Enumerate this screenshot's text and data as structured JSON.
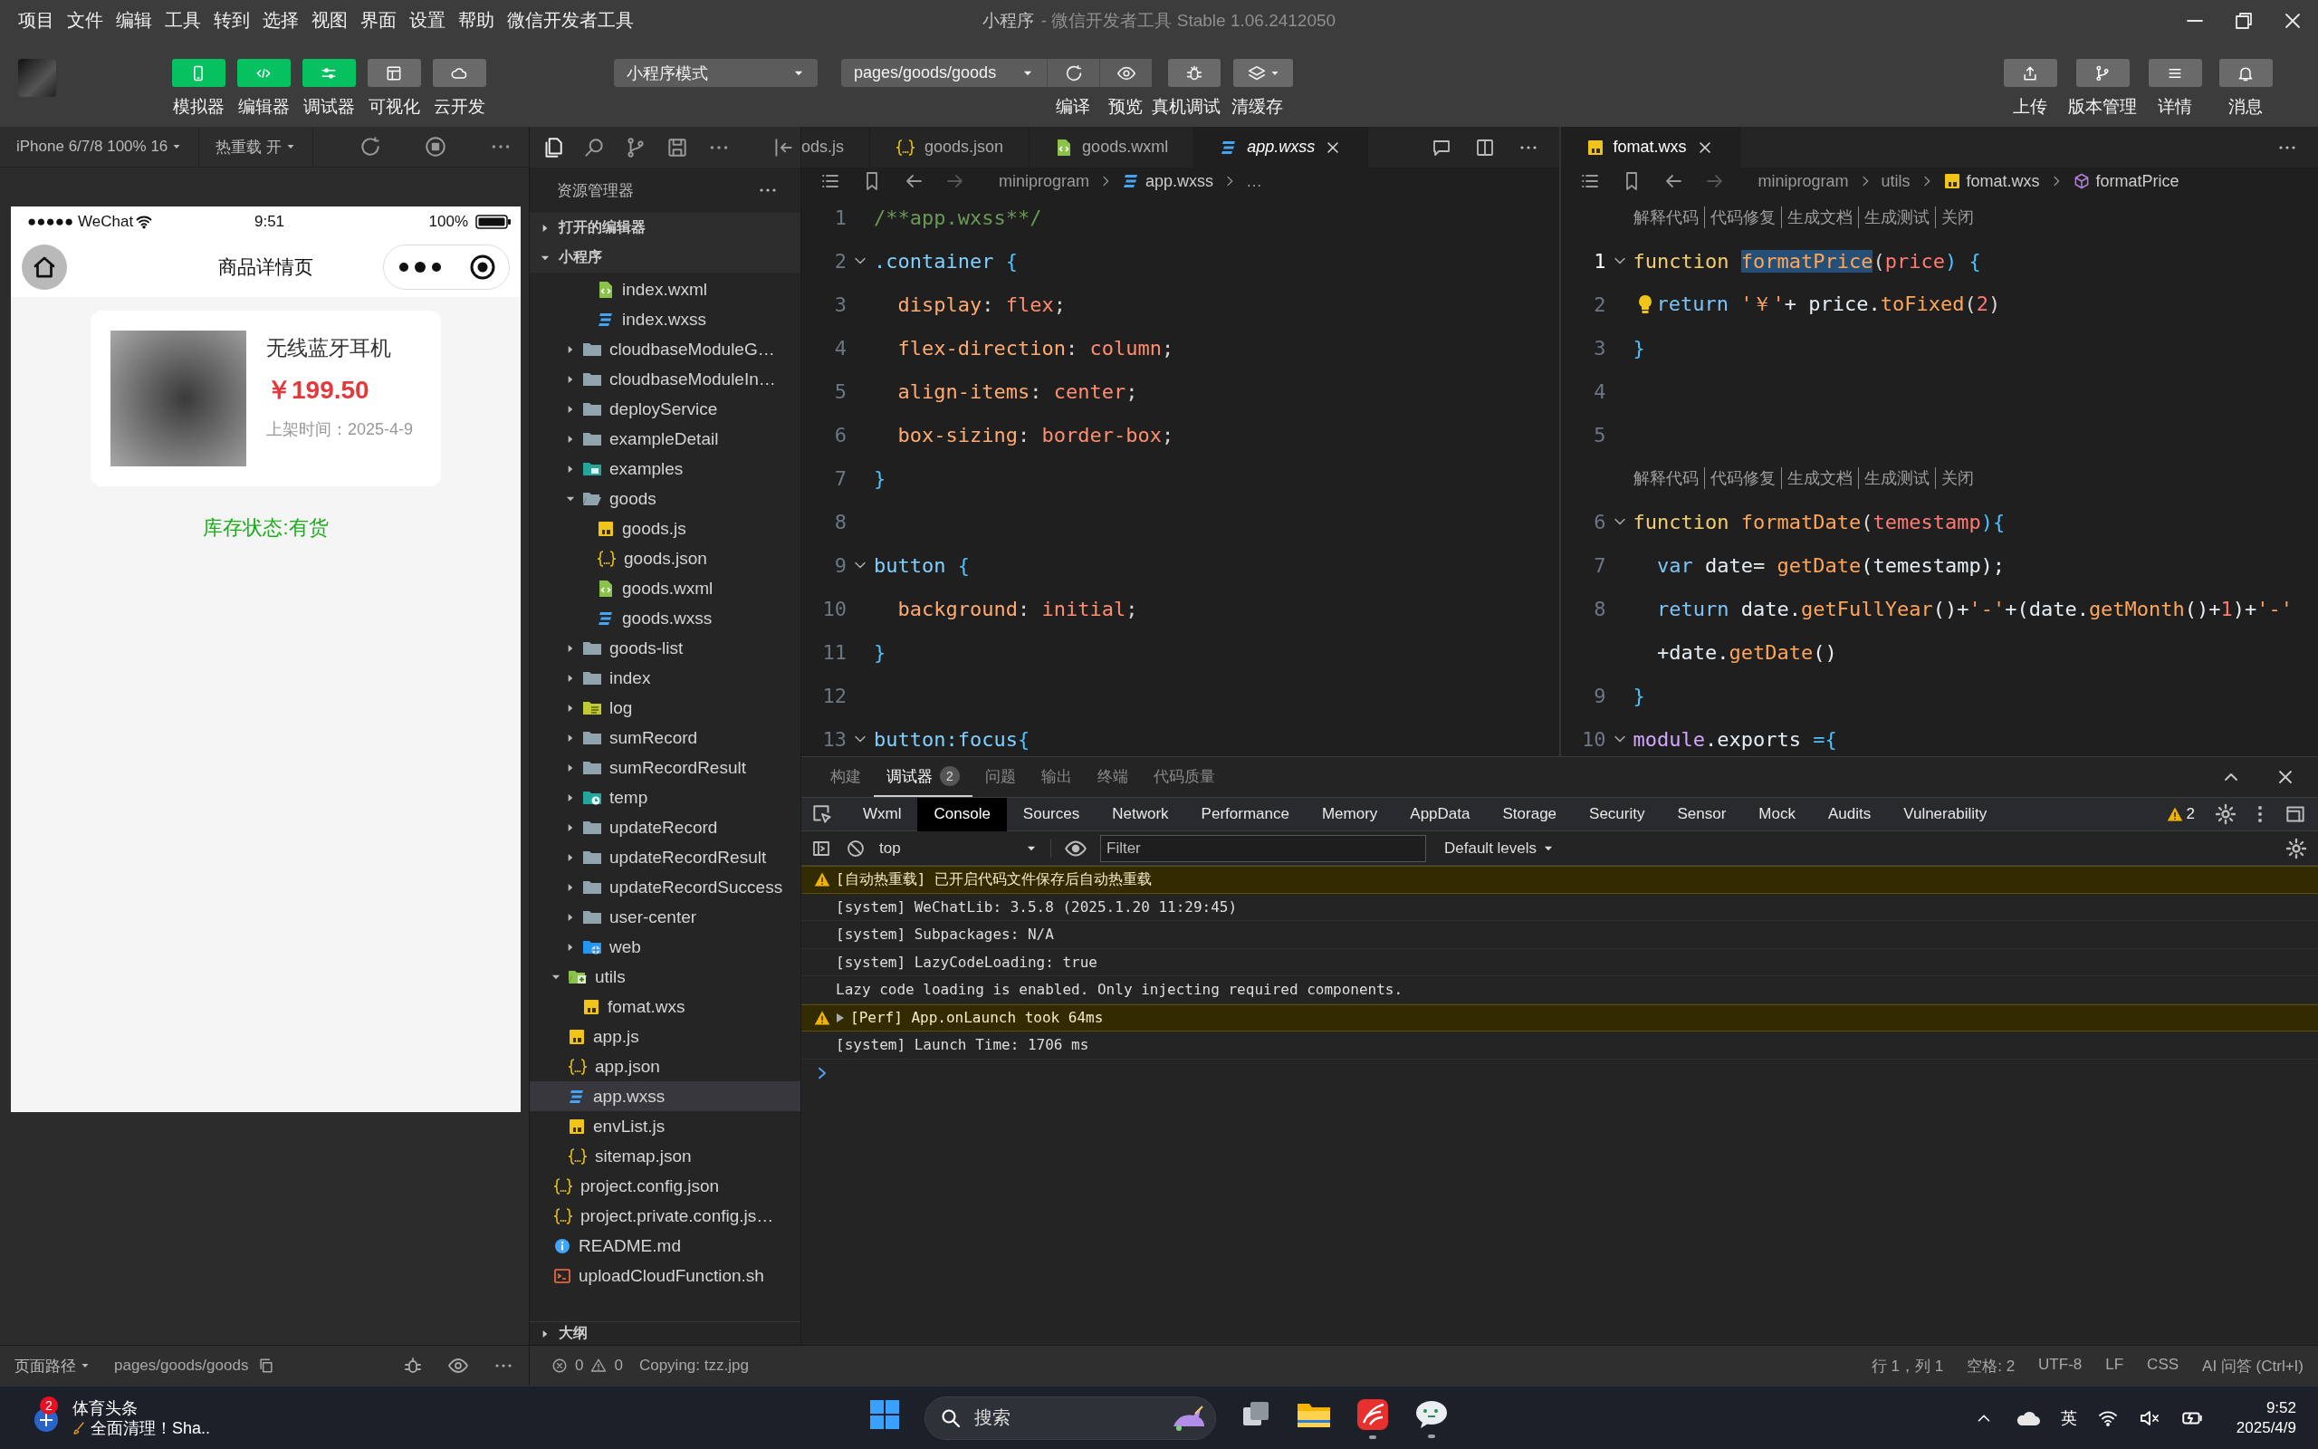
{
  "menu": [
    "项目",
    "文件",
    "编辑",
    "工具",
    "转到",
    "选择",
    "视图",
    "界面",
    "设置",
    "帮助",
    "微信开发者工具"
  ],
  "title": {
    "project": "小程序",
    "rest": "- 微信开发者工具 Stable 1.06.2412050"
  },
  "toolbar": {
    "view_toggles": [
      {
        "label": "模拟器",
        "on": true
      },
      {
        "label": "编辑器",
        "on": true
      },
      {
        "label": "调试器",
        "on": true
      },
      {
        "label": "可视化",
        "on": false
      },
      {
        "label": "云开发",
        "on": false
      }
    ],
    "mode": "小程序模式",
    "page": "pages/goods/goods",
    "actions": [
      "编译",
      "预览",
      "真机调试",
      "清缓存"
    ],
    "right": [
      "上传",
      "版本管理",
      "详情",
      "消息"
    ]
  },
  "simulator": {
    "device": "iPhone 6/7/8 100% 16",
    "hot_reload": "热重载 开",
    "carrier": "●●●●● WeChat",
    "time": "9:51",
    "battery": "100%",
    "title": "商品详情页",
    "product": {
      "name": "无线蓝牙耳机",
      "price": "￥199.50",
      "listed": "上架时间：2025-4-9"
    },
    "stock": "库存状态:有货"
  },
  "explorer": {
    "title": "资源管理器",
    "sections": [
      {
        "label": "打开的编辑器",
        "expanded": false
      },
      {
        "label": "小程序",
        "expanded": true
      }
    ],
    "tree": [
      {
        "children": [
          {
            "children": [
              {
                "children": [
                  {
                    "label": "index.wxml",
                    "kind": "wxml",
                    "selected": false
                  },
                  {
                    "label": "index.wxss",
                    "kind": "wxss",
                    "selected": false
                  }
                ]
              },
              {
                "label": "cloudbaseModuleG…",
                "kind": "folder",
                "expanded": false,
                "selected": false
              },
              {
                "label": "cloudbaseModuleIn…",
                "kind": "folder",
                "expanded": false,
                "selected": false
              },
              {
                "label": "deployService",
                "kind": "folder",
                "expanded": false,
                "selected": false
              },
              {
                "label": "exampleDetail",
                "kind": "folder",
                "expanded": false,
                "selected": false
              },
              {
                "label": "examples",
                "kind": "folder-image",
                "expanded": false,
                "selected": false
              },
              {
                "label": "goods",
                "kind": "folder",
                "expanded": true,
                "selected": false,
                "children": [
                  {
                    "label": "goods.js",
                    "kind": "js",
                    "selected": false
                  },
                  {
                    "label": "goods.json",
                    "kind": "json",
                    "selected": false
                  },
                  {
                    "label": "goods.wxml",
                    "kind": "wxml",
                    "selected": false
                  },
                  {
                    "label": "goods.wxss",
                    "kind": "wxss",
                    "selected": false
                  }
                ]
              },
              {
                "label": "goods-list",
                "kind": "folder",
                "expanded": false,
                "selected": false
              },
              {
                "label": "index",
                "kind": "folder",
                "expanded": false,
                "selected": false
              },
              {
                "label": "log",
                "kind": "folder-log",
                "expanded": false,
                "selected": false
              },
              {
                "label": "sumRecord",
                "kind": "folder",
                "expanded": false,
                "selected": false
              },
              {
                "label": "sumRecordResult",
                "kind": "folder",
                "expanded": false,
                "selected": false
              },
              {
                "label": "temp",
                "kind": "folder-temp",
                "expanded": false,
                "selected": false
              },
              {
                "label": "updateRecord",
                "kind": "folder",
                "expanded": false,
                "selected": false
              },
              {
                "label": "updateRecordResult",
                "kind": "folder",
                "expanded": false,
                "selected": false
              },
              {
                "label": "updateRecordSuccess",
                "kind": "folder",
                "expanded": false,
                "selected": false
              },
              {
                "label": "user-center",
                "kind": "folder",
                "expanded": false,
                "selected": false
              },
              {
                "label": "web",
                "kind": "folder-web",
                "expanded": false,
                "selected": false
              }
            ]
          },
          {
            "label": "utils",
            "kind": "folder-utils",
            "expanded": true,
            "selected": false,
            "children": [
              {
                "label": "fomat.wxs",
                "kind": "js",
                "selected": false
              }
            ]
          },
          {
            "label": "app.js",
            "kind": "js",
            "selected": false
          },
          {
            "label": "app.json",
            "kind": "json",
            "selected": false
          },
          {
            "label": "app.wxss",
            "kind": "wxss",
            "selected": true
          },
          {
            "label": "envList.js",
            "kind": "js",
            "selected": false
          },
          {
            "label": "sitemap.json",
            "kind": "json",
            "selected": false
          }
        ]
      },
      {
        "label": "project.config.json",
        "kind": "json",
        "selected": false
      },
      {
        "label": "project.private.config.js…",
        "kind": "json",
        "selected": false
      },
      {
        "label": "README.md",
        "kind": "md",
        "selected": false
      },
      {
        "label": "uploadCloudFunction.sh",
        "kind": "sh",
        "selected": false
      }
    ],
    "outline": {
      "label": "大纲",
      "expanded": false
    }
  },
  "editors": [
    {
      "tabs": [
        {
          "label": "ods.js",
          "selected": false,
          "preview": false
        },
        {
          "label": "goods.json",
          "kind": "json",
          "selected": false,
          "preview": false
        },
        {
          "label": "goods.wxml",
          "kind": "wxml",
          "selected": false,
          "preview": false
        },
        {
          "label": "app.wxss",
          "kind": "wxss",
          "selected": true,
          "preview": true
        }
      ],
      "breadcrumb": [
        {
          "label": "miniprogram"
        },
        {
          "label": "app.wxss",
          "kind": "wxss"
        },
        {
          "label": "…"
        }
      ],
      "lines": [
        {
          "kind": "code",
          "number": "1",
          "fold": false,
          "current": false,
          "tokens": [
            {
              "text": "/**app.wxss**/",
              "kind": "comment"
            }
          ]
        },
        {
          "kind": "code",
          "number": "2",
          "fold": true,
          "current": false,
          "tokens": [
            {
              "text": ".container",
              "kind": "selector"
            },
            {
              "text": " {",
              "kind": "brace"
            }
          ]
        },
        {
          "kind": "code",
          "number": "3",
          "fold": false,
          "current": false,
          "tokens": [
            {
              "text": "  display",
              "kind": "property"
            },
            {
              "text": ": ",
              "kind": "punct"
            },
            {
              "text": "flex",
              "kind": "value"
            },
            {
              "text": ";",
              "kind": "punct"
            }
          ]
        },
        {
          "kind": "code",
          "number": "4",
          "fold": false,
          "current": false,
          "tokens": [
            {
              "text": "  flex-direction",
              "kind": "property"
            },
            {
              "text": ": ",
              "kind": "punct"
            },
            {
              "text": "column",
              "kind": "value"
            },
            {
              "text": ";",
              "kind": "punct"
            }
          ]
        },
        {
          "kind": "code",
          "number": "5",
          "fold": false,
          "current": false,
          "tokens": [
            {
              "text": "  align-items",
              "kind": "property"
            },
            {
              "text": ": ",
              "kind": "punct"
            },
            {
              "text": "center",
              "kind": "value"
            },
            {
              "text": ";",
              "kind": "punct"
            }
          ]
        },
        {
          "kind": "code",
          "number": "6",
          "fold": false,
          "current": false,
          "tokens": [
            {
              "text": "  box-sizing",
              "kind": "property"
            },
            {
              "text": ": ",
              "kind": "punct"
            },
            {
              "text": "border-box",
              "kind": "value"
            },
            {
              "text": ";",
              "kind": "punct"
            }
          ]
        },
        {
          "kind": "code",
          "number": "7",
          "fold": false,
          "current": false,
          "tokens": [
            {
              "text": "}",
              "kind": "brace"
            }
          ]
        },
        {
          "kind": "code",
          "number": "8",
          "fold": false,
          "current": false
        },
        {
          "kind": "code",
          "number": "9",
          "fold": true,
          "current": false,
          "tokens": [
            {
              "text": "button",
              "kind": "selector"
            },
            {
              "text": " {",
              "kind": "brace"
            }
          ]
        },
        {
          "kind": "code",
          "number": "10",
          "fold": false,
          "current": false,
          "tokens": [
            {
              "text": "  background",
              "kind": "property"
            },
            {
              "text": ": ",
              "kind": "punct"
            },
            {
              "text": "initial",
              "kind": "value"
            },
            {
              "text": ";",
              "kind": "punct"
            }
          ]
        },
        {
          "kind": "code",
          "number": "11",
          "fold": false,
          "current": false,
          "tokens": [
            {
              "text": "}",
              "kind": "brace"
            }
          ]
        },
        {
          "kind": "code",
          "number": "12",
          "fold": false,
          "current": false
        },
        {
          "kind": "code",
          "number": "13",
          "fold": true,
          "current": false,
          "tokens": [
            {
              "text": "button:focus",
              "kind": "selector"
            },
            {
              "text": "{",
              "kind": "brace"
            }
          ]
        }
      ]
    },
    {
      "tabs": [
        {
          "label": "fomat.wxs",
          "kind": "js",
          "selected": true,
          "preview": false
        }
      ],
      "breadcrumb": [
        {
          "label": "miniprogram"
        },
        {
          "label": "utils"
        },
        {
          "label": "fomat.wxs",
          "kind": "js"
        },
        {
          "label": "formatPrice",
          "kind": "symbol"
        }
      ],
      "lines": [
        {
          "kind": "codelens",
          "actions": [
            "解释代码",
            "代码修复",
            "生成文档",
            "生成测试",
            "关闭"
          ]
        },
        {
          "kind": "code",
          "number": "1",
          "fold": true,
          "current": true,
          "hint": false,
          "tokens": [
            {
              "text": "function ",
              "kind": "keyword"
            },
            {
              "text": "formatPrice",
              "kind": "function-match"
            },
            {
              "text": "(",
              "kind": "punct"
            },
            {
              "text": "price",
              "kind": "param"
            },
            {
              "text": ") {",
              "kind": "brace"
            }
          ]
        },
        {
          "kind": "code",
          "number": "2",
          "fold": false,
          "current": false,
          "hint": true,
          "tokens": [
            {
              "text": "return ",
              "kind": "control"
            },
            {
              "text": "'￥'",
              "kind": "string"
            },
            {
              "text": "+ price.",
              "kind": "plain"
            },
            {
              "text": "toFixed",
              "kind": "function"
            },
            {
              "text": "(",
              "kind": "punct"
            },
            {
              "text": "2",
              "kind": "number"
            },
            {
              "text": ")",
              "kind": "punct"
            }
          ]
        },
        {
          "kind": "code",
          "number": "3",
          "fold": false,
          "current": false,
          "hint": false,
          "tokens": [
            {
              "text": "}",
              "kind": "brace"
            }
          ]
        },
        {
          "kind": "code",
          "number": "4",
          "fold": false,
          "current": false,
          "hint": false
        },
        {
          "kind": "code",
          "number": "5",
          "fold": false,
          "current": false,
          "hint": false
        },
        {
          "kind": "codelens",
          "actions": [
            "解释代码",
            "代码修复",
            "生成文档",
            "生成测试",
            "关闭"
          ]
        },
        {
          "kind": "code",
          "number": "6",
          "fold": true,
          "current": false,
          "hint": false,
          "tokens": [
            {
              "text": "function ",
              "kind": "keyword"
            },
            {
              "text": "formatDate",
              "kind": "function"
            },
            {
              "text": "(",
              "kind": "punct"
            },
            {
              "text": "temestamp",
              "kind": "param"
            },
            {
              "text": "){",
              "kind": "brace"
            }
          ]
        },
        {
          "kind": "code",
          "number": "7",
          "fold": false,
          "current": false,
          "hint": false,
          "tokens": [
            {
              "text": "  var",
              "kind": "control"
            },
            {
              "text": " date= ",
              "kind": "plain"
            },
            {
              "text": "getDate",
              "kind": "function"
            },
            {
              "text": "(temestamp);",
              "kind": "plain"
            }
          ]
        },
        {
          "kind": "code",
          "number": "8",
          "fold": false,
          "current": false,
          "hint": false,
          "tokens": [
            {
              "text": "  return",
              "kind": "control"
            },
            {
              "text": " date.",
              "kind": "plain"
            },
            {
              "text": "getFullYear",
              "kind": "function"
            },
            {
              "text": "()+",
              "kind": "plain"
            },
            {
              "text": "'-'",
              "kind": "string"
            },
            {
              "text": "+(date.",
              "kind": "plain"
            },
            {
              "text": "getMonth",
              "kind": "function"
            },
            {
              "text": "()+",
              "kind": "plain"
            },
            {
              "text": "1",
              "kind": "number"
            },
            {
              "text": ")+",
              "kind": "plain"
            },
            {
              "text": "'-'",
              "kind": "string"
            }
          ]
        },
        {
          "kind": "wrap",
          "tokens": [
            {
              "text": "  +date.",
              "kind": "plain"
            },
            {
              "text": "getDate",
              "kind": "function"
            },
            {
              "text": "()",
              "kind": "plain"
            }
          ]
        },
        {
          "kind": "code",
          "number": "9",
          "fold": false,
          "current": false,
          "hint": false,
          "tokens": [
            {
              "text": "}",
              "kind": "brace"
            }
          ]
        },
        {
          "kind": "code",
          "number": "10",
          "fold": true,
          "current": false,
          "hint": false,
          "tokens": [
            {
              "text": "module",
              "kind": "module"
            },
            {
              "text": ".exports",
              "kind": "plain"
            },
            {
              "text": " ={",
              "kind": "brace"
            }
          ]
        }
      ]
    }
  ],
  "debugger": {
    "tabs": [
      {
        "label": "构建",
        "selected": false
      },
      {
        "label": "调试器",
        "selected": true,
        "badge": "2"
      },
      {
        "label": "问题",
        "selected": false
      },
      {
        "label": "输出",
        "selected": false
      },
      {
        "label": "终端",
        "selected": false
      },
      {
        "label": "代码质量",
        "selected": false
      }
    ],
    "devtools_tabs": [
      {
        "label": "Wxml",
        "selected": false
      },
      {
        "label": "Console",
        "selected": true
      },
      {
        "label": "Sources",
        "selected": false
      },
      {
        "label": "Network",
        "selected": false
      },
      {
        "label": "Performance",
        "selected": false
      },
      {
        "label": "Memory",
        "selected": false
      },
      {
        "label": "AppData",
        "selected": false
      },
      {
        "label": "Storage",
        "selected": false
      },
      {
        "label": "Security",
        "selected": false
      },
      {
        "label": "Sensor",
        "selected": false
      },
      {
        "label": "Mock",
        "selected": false
      },
      {
        "label": "Audits",
        "selected": false
      },
      {
        "label": "Vulnerability",
        "selected": false
      }
    ],
    "warning_count": "2",
    "context": "top",
    "filter_placeholder": "Filter",
    "levels": "Default levels",
    "messages": [
      {
        "kind": "warning",
        "expandable": false,
        "text": "[自动热重载] 已开启代码文件保存后自动热重载"
      },
      {
        "kind": "info",
        "expandable": false,
        "text": "[system] WeChatLib: 3.5.8 (2025.1.20 11:29:45)"
      },
      {
        "kind": "info",
        "expandable": false,
        "text": "[system] Subpackages: N/A"
      },
      {
        "kind": "info",
        "expandable": false,
        "text": "[system] LazyCodeLoading: true"
      },
      {
        "kind": "info",
        "expandable": false,
        "text": "Lazy code loading is enabled. Only injecting required components."
      },
      {
        "kind": "warning",
        "expandable": true,
        "text": "[Perf] App.onLaunch took 64ms"
      },
      {
        "kind": "info",
        "expandable": false,
        "text": "[system] Launch Time: 1706 ms"
      }
    ]
  },
  "status_bar": {
    "page_path_label": "页面路径",
    "page_path": "pages/goods/goods",
    "errors": "0",
    "warnings": "0",
    "message": "Copying: tzz.jpg",
    "items": [
      "行 1，列 1",
      "空格: 2",
      "UTF-8",
      "LF",
      "CSS",
      "AI 问答 (Ctrl+I)"
    ]
  },
  "taskbar": {
    "news": {
      "badge": "2",
      "title": "体育头条",
      "subtitle": "全面清理！Sha.."
    },
    "search": {
      "placeholder": "搜索"
    },
    "ime": "英",
    "time": "9:52",
    "date": "2025/4/9"
  }
}
